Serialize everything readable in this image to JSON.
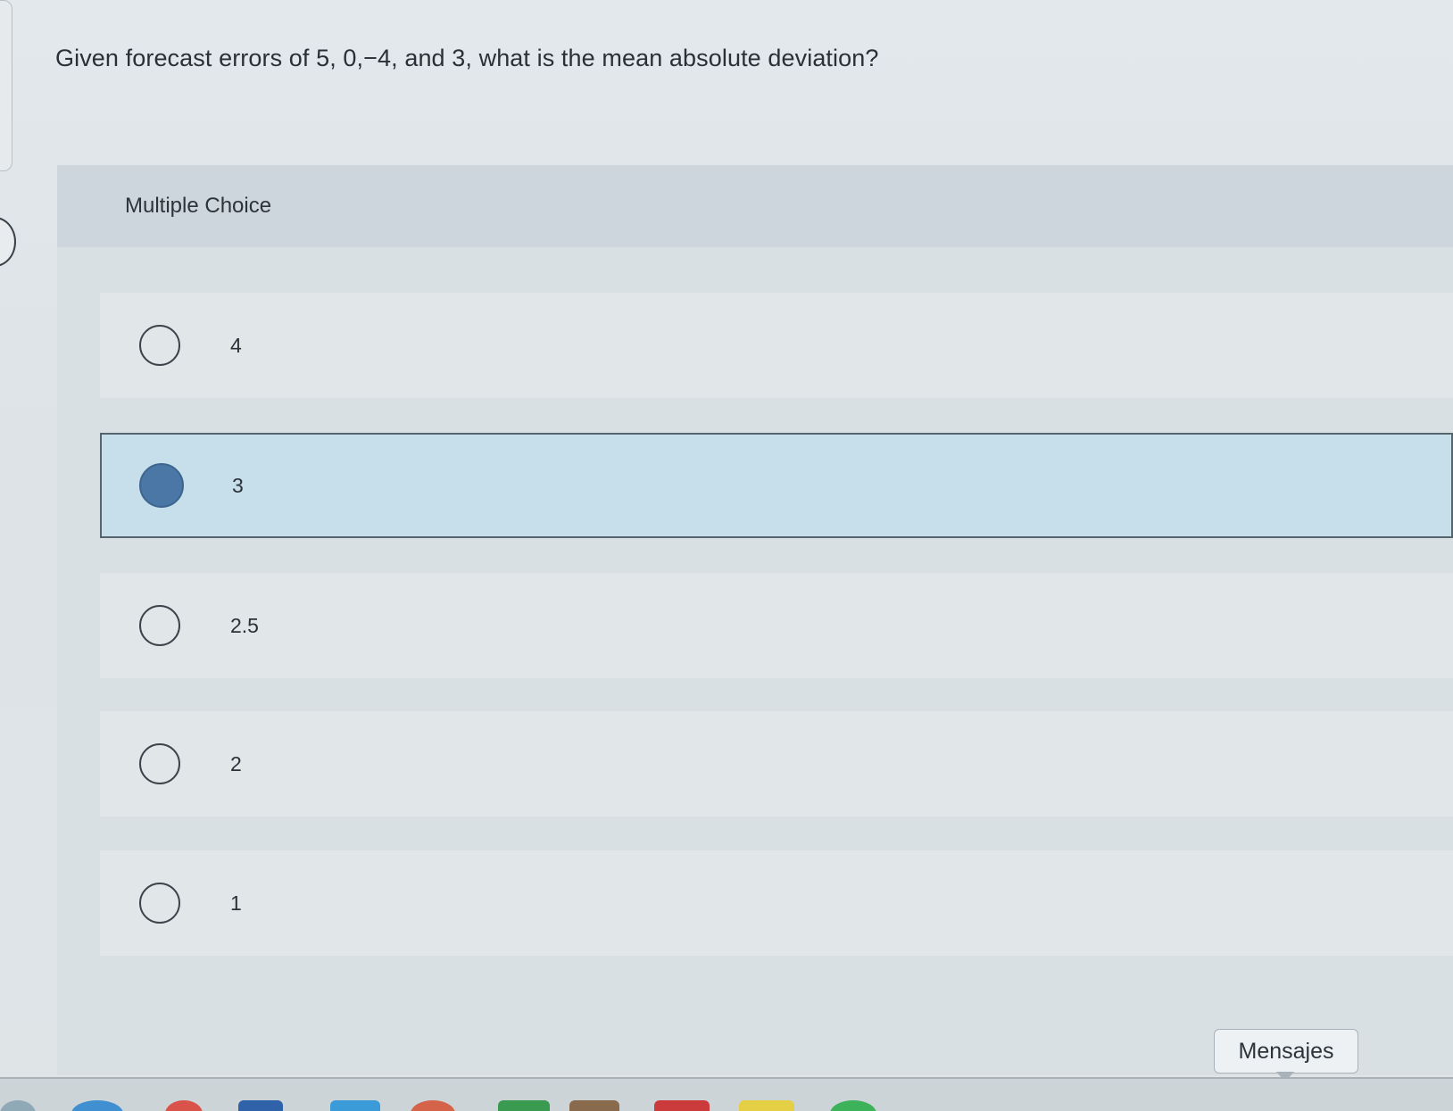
{
  "question": {
    "text": "Given forecast errors of 5, 0,−4, and 3, what is the mean absolute deviation?"
  },
  "multiple_choice": {
    "header": "Multiple Choice",
    "selected_index": 1,
    "options": [
      {
        "value": "4",
        "selected": false
      },
      {
        "value": "3",
        "selected": true
      },
      {
        "value": "2.5",
        "selected": false
      },
      {
        "value": "2",
        "selected": false
      },
      {
        "value": "1",
        "selected": false
      }
    ]
  },
  "chat": {
    "button_label": "Mensajes"
  },
  "colors": {
    "selected_fill": "#4a77a6",
    "selected_background": "#c6dfea",
    "header_background": "#ccd6dc"
  },
  "dock_icons": [
    "app-icon",
    "app-icon",
    "app-icon",
    "app-icon",
    "app-icon",
    "app-icon",
    "app-icon",
    "app-icon",
    "app-icon",
    "app-icon",
    "app-icon"
  ]
}
